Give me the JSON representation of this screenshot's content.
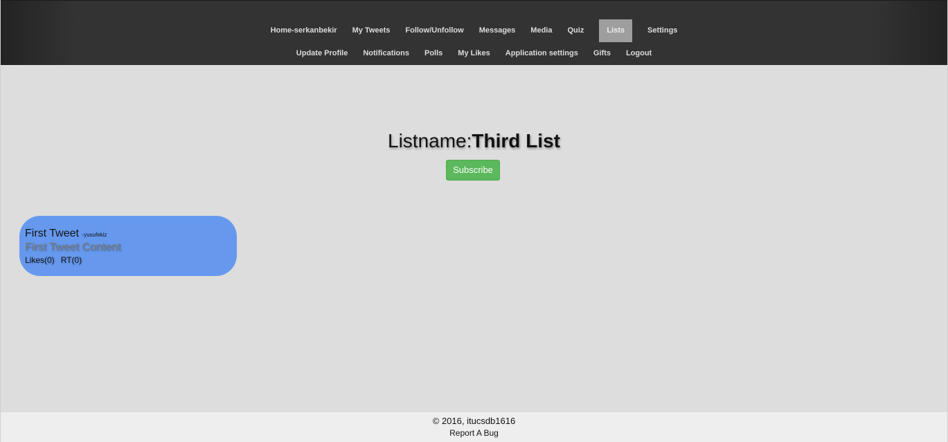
{
  "nav": {
    "row1": [
      {
        "label": "Home-serkanbekir"
      },
      {
        "label": "My Tweets"
      },
      {
        "label": "Follow/Unfollow"
      },
      {
        "label": "Messages"
      },
      {
        "label": "Media"
      },
      {
        "label": "Quiz"
      },
      {
        "label": "Lists"
      },
      {
        "label": "Settings"
      }
    ],
    "row2": [
      {
        "label": "Update Profile"
      },
      {
        "label": "Notifications"
      },
      {
        "label": "Polls"
      },
      {
        "label": "My Likes"
      },
      {
        "label": "Application settings"
      },
      {
        "label": "Gifts"
      },
      {
        "label": "Logout"
      }
    ],
    "active_label": "Lists"
  },
  "list": {
    "label": "Listname:",
    "name": "Third List",
    "subscribe_label": "Subscribe"
  },
  "tweet": {
    "title": "First Tweet",
    "author": "-yusufekiz",
    "content": "First Tweet Content",
    "likes": "Likes(0)",
    "rt": "RT(0)"
  },
  "footer": {
    "copyright": "© 2016, itucsdb1616",
    "report_bug": "Report A Bug"
  },
  "colors": {
    "navbar": "#333333",
    "active_tab": "#9e9e9e",
    "subscribe": "#5cb85c",
    "tweet_card": "#6699ee",
    "background": "#dddddd",
    "footer": "#eeeeee"
  }
}
